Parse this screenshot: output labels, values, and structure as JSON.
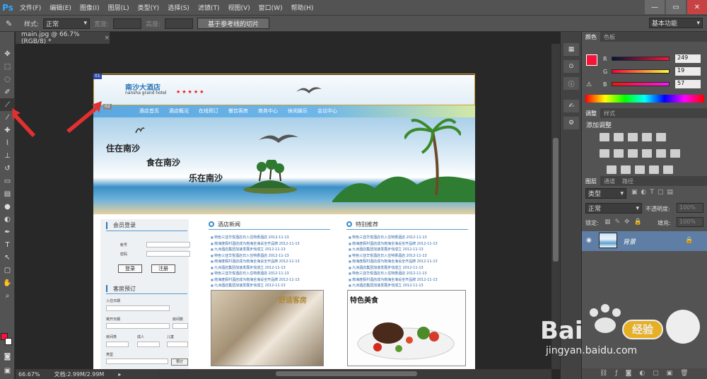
{
  "app": {
    "logo": "Ps"
  },
  "menu": [
    "文件(F)",
    "编辑(E)",
    "图像(I)",
    "图层(L)",
    "类型(Y)",
    "选择(S)",
    "滤镜(T)",
    "视图(V)",
    "窗口(W)",
    "帮助(H)"
  ],
  "window_controls": {
    "minimize": "—",
    "restore": "▭",
    "close": "✕"
  },
  "options": {
    "style_label": "样式:",
    "style_value": "正常",
    "width_label": "宽度:",
    "height_label": "高度:",
    "slice_button": "基于参考线的切片",
    "workspace": "基本功能"
  },
  "document": {
    "tab_title": "main.jpg @ 66.7%(RGB/8) *",
    "close": "×"
  },
  "status": {
    "zoom": "66.67%",
    "doc_info": "文档:2.99M/2.99M"
  },
  "slices": {
    "slice1": "01",
    "slice2": "02"
  },
  "color_panel": {
    "tabs": [
      "颜色",
      "色板"
    ],
    "r_label": "R",
    "g_label": "G",
    "b_label": "B",
    "r": 249,
    "g": 19,
    "b": 57,
    "fg_color": "#f91339"
  },
  "adjust_panel": {
    "tabs": [
      "调整",
      "样式"
    ],
    "title": "添加调整"
  },
  "layers_panel": {
    "tabs": [
      "图层",
      "通道",
      "路径"
    ],
    "filter": "类型",
    "blend": "正常",
    "opacity_label": "不透明度:",
    "opacity": "100%",
    "lock_label": "锁定:",
    "fill_label": "填充:",
    "fill": "100%",
    "layer_name": "背景"
  },
  "webpage": {
    "site_name": "南沙大酒店",
    "site_name_en": "nansha grand hotel",
    "stars": "★★★★★",
    "nav": [
      "酒店首页",
      "酒店概况",
      "在线预订",
      "餐饮客房",
      "商务中心",
      "休闲娱乐",
      "会议中心"
    ],
    "banner_lines": [
      "住在南沙",
      "食在南沙",
      "乐在南沙"
    ],
    "member_login": {
      "title": "会员登录",
      "account_label": "帐号",
      "password_label": "密码",
      "login_btn": "登录",
      "register_btn": "注册"
    },
    "booking": {
      "title": "客房预订",
      "checkin": "入住日期",
      "checkout": "离开日期",
      "nights": "房间数",
      "room_type": "房间类",
      "adults": "成人",
      "children": "儿童",
      "kind": "类型",
      "submit": "预订"
    },
    "hotel_news": {
      "title": "酒店新闻",
      "items": [
        "特色三亚华悦酒店日入住特惠酒店 2012-11-13",
        "南海度假村酒店成为南海全海设全开品牌 2012-11-13",
        "九洲酒店集团加速发展步伐成立 2012-11-13",
        "特色三亚华悦酒店日入住特惠酒店 2012-11-13",
        "南海度假村酒店成为南海全海设全开品牌 2012-11-13",
        "九洲酒店集团加速发展步伐成立 2012-11-13",
        "特色三亚华悦酒店日入住特惠酒店 2012-11-13",
        "南海度假村酒店成为南海全海设全开品牌 2012-11-13",
        "九洲酒店集团加速发展步伐成立 2012-11-13"
      ],
      "image_caption": "舒适客房"
    },
    "recommend": {
      "title": "特别推荐",
      "items": [
        "特色三亚华悦酒店日入住特惠酒店 2012-11-13",
        "南海度假村酒店成为南海全海设全开品牌 2012-11-13",
        "九洲酒店集团加速发展步伐成立 2012-11-13",
        "特色三亚华悦酒店日入住特惠酒店 2012-11-13",
        "南海度假村酒店成为南海全海设全开品牌 2012-11-13",
        "九洲酒店集团加速发展步伐成立 2012-11-13",
        "特色三亚华悦酒店日入住特惠酒店 2012-11-13",
        "南海度假村酒店成为南海全海设全开品牌 2012-11-13",
        "九洲酒店集团加速发展步伐成立 2012-11-13"
      ],
      "image_caption": "特色美食"
    }
  },
  "watermark": {
    "brand": "Bai",
    "brand2": "经验",
    "url": "jingyan.baidu.com"
  }
}
